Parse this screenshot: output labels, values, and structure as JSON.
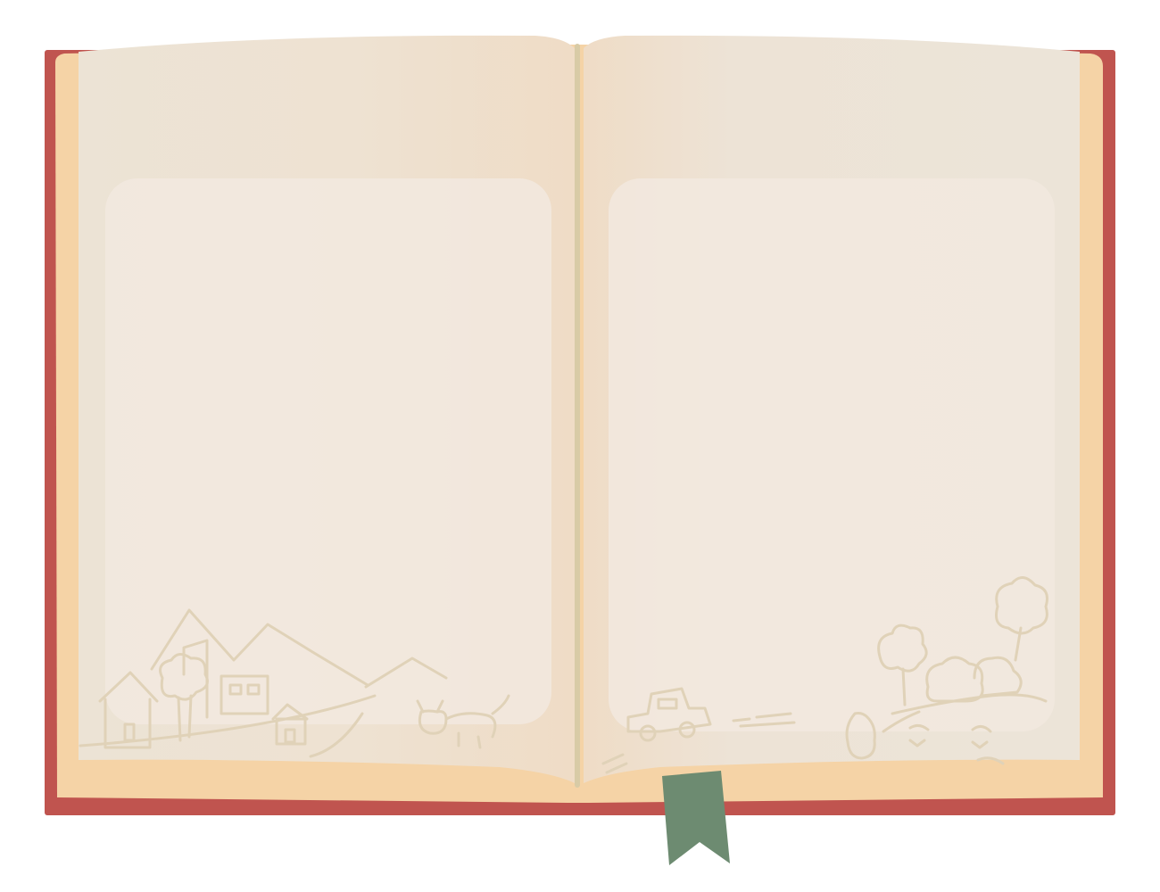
{
  "book": {
    "cover_color": "#c0544f",
    "page_edge_color": "#f5d3a6",
    "page_color": "#efe3d3",
    "panel_color": "#f2e9df",
    "spine_color": "#d8cba6",
    "sketch_color": "#e0d2b8",
    "bookmark_color": "#6d8b71"
  },
  "left_page": {
    "doodle_icons": [
      "mountain-icon",
      "house-icon",
      "building-icon",
      "tree-icon",
      "cat-icon"
    ]
  },
  "right_page": {
    "doodle_icons": [
      "car-icon",
      "tree-icon",
      "bush-icon",
      "face-icon"
    ]
  }
}
